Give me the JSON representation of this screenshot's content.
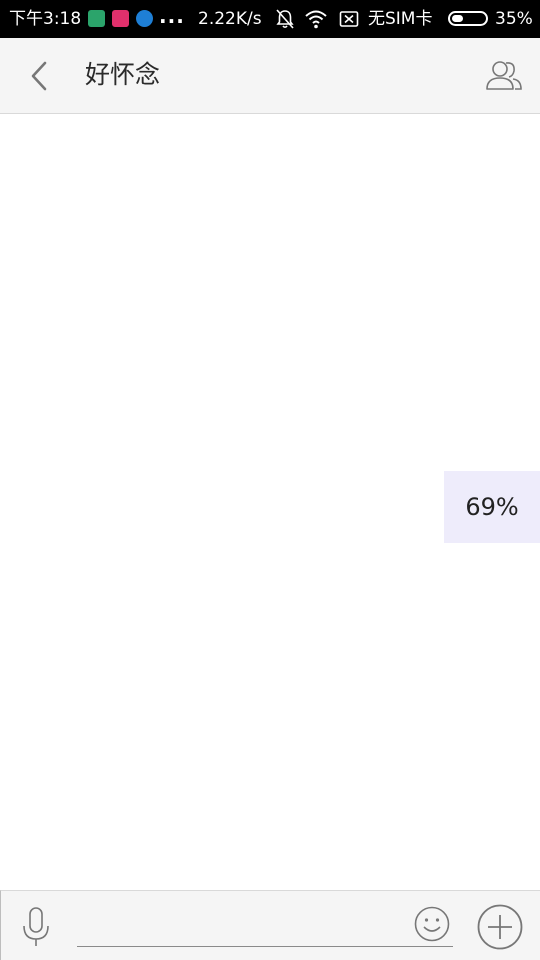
{
  "status_bar": {
    "time": "下午3:18",
    "more": "...",
    "network_speed": "2.22K/s",
    "sim_status": "无SIM卡",
    "battery_percent": "35%",
    "battery_level": 0.35,
    "icons": [
      "app-notification-icon",
      "app-notification-icon",
      "app-notification-icon",
      "bell-muted-icon",
      "wifi-icon",
      "no-sim-icon",
      "battery-icon"
    ]
  },
  "header": {
    "title": "好怀念",
    "back_icon": "chevron-left-icon",
    "members_icon": "group-members-icon"
  },
  "progress": {
    "label": "69%",
    "value": 69
  },
  "input_bar": {
    "message_value": "",
    "mic_icon": "microphone-icon",
    "emoji_icon": "smiley-icon",
    "plus_icon": "plus-circle-icon"
  },
  "colors": {
    "status_bar_bg": "#000000",
    "header_bg": "#f5f5f5",
    "progress_bg": "#eeecfb",
    "icon_gray": "#777777"
  }
}
